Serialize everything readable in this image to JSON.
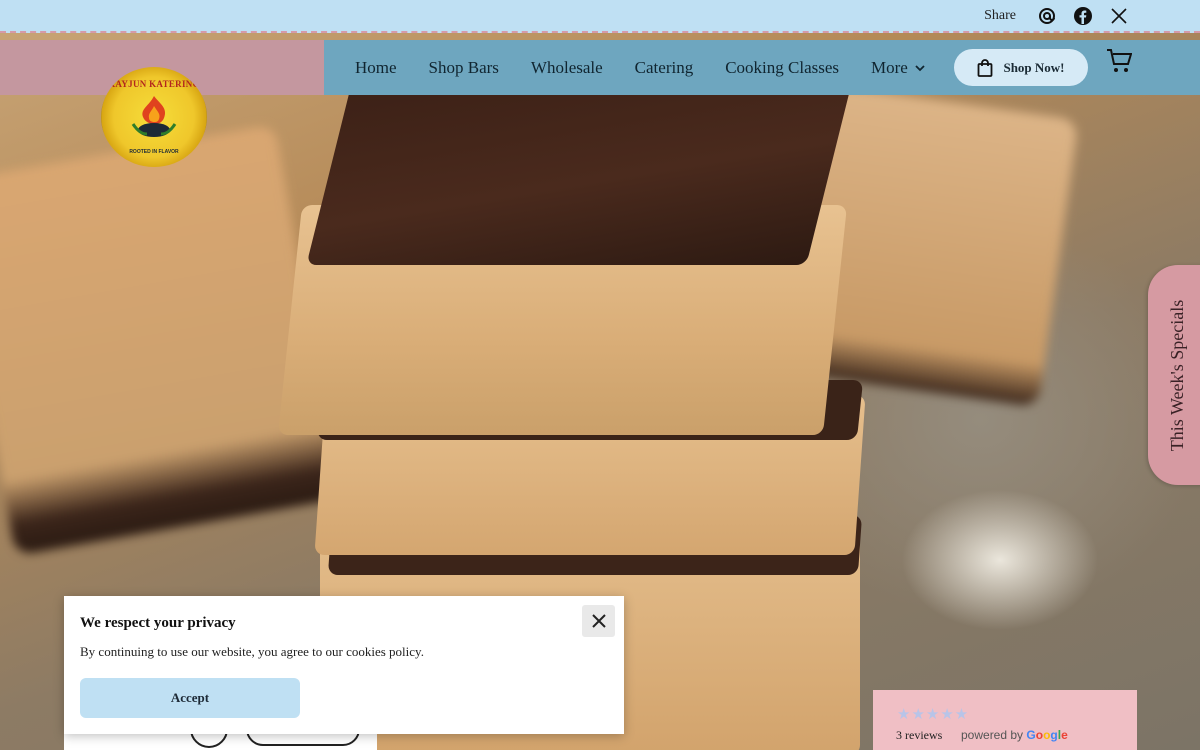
{
  "topbar": {
    "share_label": "Share",
    "icons": [
      "threads-icon",
      "facebook-icon",
      "x-icon"
    ]
  },
  "logo": {
    "title": "KAYJUN KATERING",
    "tagline": "ROOTED IN FLAVOR"
  },
  "nav": {
    "items": [
      "Home",
      "Shop Bars",
      "Wholesale",
      "Catering",
      "Cooking Classes"
    ],
    "more_label": "More",
    "shop_button": "Shop Now!"
  },
  "side_tab": {
    "label": "This Week's Specials"
  },
  "privacy": {
    "title": "We respect your privacy",
    "text": "By continuing to use our website, you agree to our cookies policy.",
    "accept_label": "Accept"
  },
  "reviews": {
    "stars": "★★★★★",
    "count_label": "3 reviews",
    "powered_by": "powered by"
  },
  "colors": {
    "topbar_bg": "#bfe0f3",
    "nav_bg": "#6ea6bf",
    "header_pink": "#c4979f",
    "side_tab": "#d69aa2",
    "reviews_bg": "#f0bfc5"
  }
}
